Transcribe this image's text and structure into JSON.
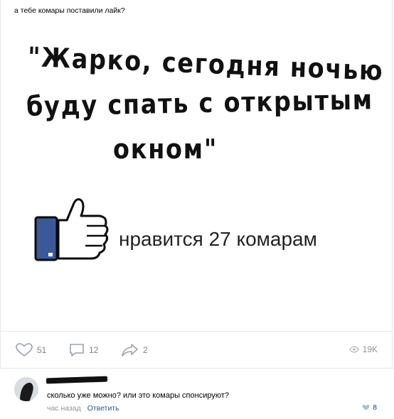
{
  "post": {
    "text": "а тебе комары поставили лайк?",
    "meme": {
      "line1": "\"Жарко, сегодня ночью",
      "line2": "буду спать с открытым",
      "line3": "окном\"",
      "caption": "нравится 27 комарам"
    },
    "actions": {
      "likes": "51",
      "comments": "12",
      "shares": "2",
      "views": "19K"
    }
  },
  "comment": {
    "text": "сколько уже можно? или это комары спонсируют?",
    "time": "час назад",
    "reply_label": "Ответить",
    "likes": "8"
  },
  "colors": {
    "thumb_cuff": "#3b5998",
    "link": "#2a5885",
    "muted": "#828282"
  }
}
